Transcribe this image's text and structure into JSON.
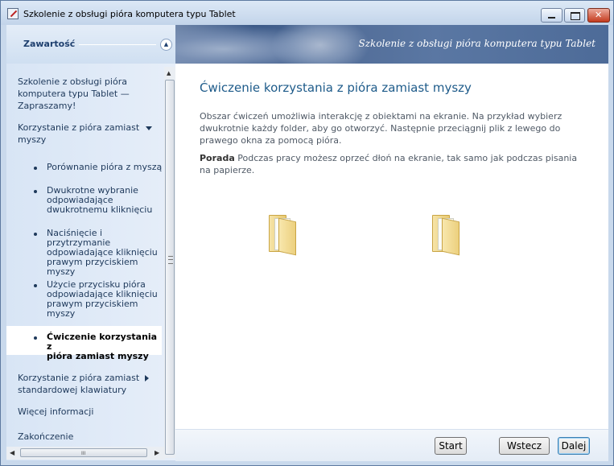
{
  "window": {
    "title": "Szkolenie z obsługi pióra komputera typu Tablet"
  },
  "sidebar": {
    "header": "Zawartość",
    "items": [
      {
        "label_lines": [
          "Szkolenie z obsługi pióra",
          "komputera typu Tablet —",
          "Zapraszamy!"
        ]
      },
      {
        "label_lines": [
          "Korzystanie z pióra zamiast",
          "myszy"
        ]
      },
      {
        "label_lines": [
          "Korzystanie z pióra zamiast",
          "standardowej klawiatury"
        ]
      },
      {
        "label_lines": [
          "Więcej informacji"
        ]
      },
      {
        "label_lines": [
          "Zakończenie"
        ]
      }
    ],
    "subitems": [
      {
        "label_lines": [
          "Porównanie pióra z myszą"
        ]
      },
      {
        "label_lines": [
          "Dwukrotne wybranie",
          "odpowiadające",
          "dwukrotnemu kliknięciu"
        ]
      },
      {
        "label_lines": [
          "Naciśnięcie i przytrzymanie",
          "odpowiadające kliknięciu",
          "prawym przyciskiem",
          "myszy"
        ]
      },
      {
        "label_lines": [
          "Użycie przycisku pióra",
          "odpowiadające kliknięciu",
          "prawym przyciskiem",
          "myszy"
        ]
      },
      {
        "label_lines": [
          "Ćwiczenie korzystania z",
          "pióra zamiast myszy"
        ]
      }
    ],
    "hscroll_grip": "III"
  },
  "banner": {
    "title": "Szkolenie z obsługi pióra komputera typu Tablet"
  },
  "main": {
    "heading": "Ćwiczenie korzystania z pióra zamiast myszy",
    "paragraph": "Obszar ćwiczeń umożliwia interakcję z obiektami na ekranie. Na przykład wybierz dwukrotnie każdy folder, aby go otworzyć. Następnie przeciągnij plik z lewego do prawego okna za pomocą pióra.",
    "tip_label": "Porada",
    "tip_text": " Podczas pracy możesz oprzeć dłoń na ekranie, tak samo jak podczas pisania na papierze."
  },
  "footer": {
    "start": "Start",
    "back": "Wstecz",
    "next": "Dalej"
  },
  "icons": {
    "folder_left": "folder-icon",
    "folder_right": "folder-icon"
  }
}
